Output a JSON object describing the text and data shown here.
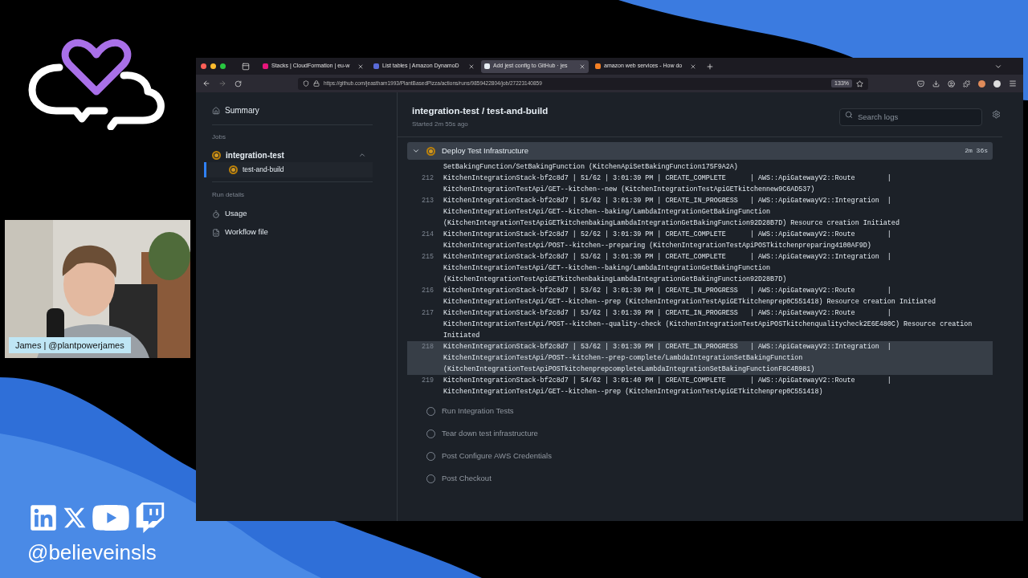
{
  "overlay": {
    "caption": "James | @plantpowerjames",
    "handle": "@believeinsls"
  },
  "browser": {
    "tabs": [
      {
        "title": "Stacks | CloudFormation | eu-w",
        "selected": false,
        "color": "#e7157b"
      },
      {
        "title": "List tables | Amazon DynamoD",
        "selected": false,
        "color": "#5a6bd8"
      },
      {
        "title": "Add jest config to GitHub · jes",
        "selected": true,
        "color": "#e6edf3"
      },
      {
        "title": "amazon web services - How do",
        "selected": false,
        "color": "#f48024"
      }
    ],
    "url": "https://github.com/jeastham1993/PlantBasedPizza/actions/runs/9859422804/job/27223140859",
    "zoom": "133%"
  },
  "sidebar": {
    "summary": "Summary",
    "jobs_heading": "Jobs",
    "jobs": [
      {
        "name": "integration-test",
        "kind": "running",
        "expanded": true,
        "children": [
          {
            "name": "test-and-build",
            "kind": "running",
            "selected": true
          }
        ]
      }
    ],
    "run_details_heading": "Run details",
    "run_details": [
      {
        "label": "Usage",
        "kind": "usage"
      },
      {
        "label": "Workflow file",
        "kind": "workflow"
      }
    ]
  },
  "job": {
    "title": "integration-test / test-and-build",
    "started": "Started 2m 55s ago",
    "search": {
      "placeholder": "Search logs"
    }
  },
  "steps": [
    {
      "name": "Deploy Test Infrastructure",
      "kind": "running",
      "expanded": true,
      "duration": "2m 36s",
      "log": [
        {
          "lines": [
            "SetBakingFunction/SetBakingFunction (KitchenApiSetBakingFunction175F9A2A)"
          ],
          "highlighted": false
        },
        {
          "number": "212",
          "lines": [
            "KitchenIntegrationStack-bf2c8d7 | 51/62 | 3:01:39 PM | CREATE_COMPLETE      | AWS::ApiGatewayV2::Route        |",
            "KitchenIntegrationTestApi/GET--kitchen--new (KitchenIntegrationTestApiGETkitchennew9C6AD537)"
          ],
          "highlighted": false
        },
        {
          "number": "213",
          "lines": [
            "KitchenIntegrationStack-bf2c8d7 | 51/62 | 3:01:39 PM | CREATE_IN_PROGRESS   | AWS::ApiGatewayV2::Integration  |",
            "KitchenIntegrationTestApi/GET--kitchen--baking/LambdaIntegrationGetBakingFunction",
            "(KitchenIntegrationTestApiGETkitchenbakingLambdaIntegrationGetBakingFunction92D28B7D) Resource creation Initiated"
          ],
          "highlighted": false
        },
        {
          "number": "214",
          "lines": [
            "KitchenIntegrationStack-bf2c8d7 | 52/62 | 3:01:39 PM | CREATE_COMPLETE      | AWS::ApiGatewayV2::Route        |",
            "KitchenIntegrationTestApi/POST--kitchen--preparing (KitchenIntegrationTestApiPOSTkitchenpreparing4100AF9D)"
          ],
          "highlighted": false
        },
        {
          "number": "215",
          "lines": [
            "KitchenIntegrationStack-bf2c8d7 | 53/62 | 3:01:39 PM | CREATE_COMPLETE      | AWS::ApiGatewayV2::Integration  |",
            "KitchenIntegrationTestApi/GET--kitchen--baking/LambdaIntegrationGetBakingFunction",
            "(KitchenIntegrationTestApiGETkitchenbakingLambdaIntegrationGetBakingFunction92D28B7D)"
          ],
          "highlighted": false
        },
        {
          "number": "216",
          "lines": [
            "KitchenIntegrationStack-bf2c8d7 | 53/62 | 3:01:39 PM | CREATE_IN_PROGRESS   | AWS::ApiGatewayV2::Route        |",
            "KitchenIntegrationTestApi/GET--kitchen--prep (KitchenIntegrationTestApiGETkitchenprep0C551418) Resource creation Initiated"
          ],
          "highlighted": false
        },
        {
          "number": "217",
          "lines": [
            "KitchenIntegrationStack-bf2c8d7 | 53/62 | 3:01:39 PM | CREATE_IN_PROGRESS   | AWS::ApiGatewayV2::Route        |",
            "KitchenIntegrationTestApi/POST--kitchen--quality-check (KitchenIntegrationTestApiPOSTkitchenqualitycheck2E6E480C) Resource creation",
            "Initiated"
          ],
          "highlighted": false
        },
        {
          "number": "218",
          "lines": [
            "KitchenIntegrationStack-bf2c8d7 | 53/62 | 3:01:39 PM | CREATE_IN_PROGRESS   | AWS::ApiGatewayV2::Integration  |",
            "KitchenIntegrationTestApi/POST--kitchen--prep-complete/LambdaIntegrationSetBakingFunction",
            "(KitchenIntegrationTestApiPOSTkitchenprepcompleteLambdaIntegrationSetBakingFunctionF8C4B981)"
          ],
          "highlighted": true
        },
        {
          "number": "219",
          "lines": [
            "KitchenIntegrationStack-bf2c8d7 | 54/62 | 3:01:40 PM | CREATE_COMPLETE      | AWS::ApiGatewayV2::Route        |",
            "KitchenIntegrationTestApi/GET--kitchen--prep (KitchenIntegrationTestApiGETkitchenprep0C551418)"
          ],
          "highlighted": false
        }
      ]
    },
    {
      "name": "Run Integration Tests",
      "kind": "pending",
      "expanded": false
    },
    {
      "name": "Tear down test infrastructure",
      "kind": "pending",
      "expanded": false
    },
    {
      "name": "Post Configure AWS Credentials",
      "kind": "pending",
      "expanded": false
    },
    {
      "name": "Post Checkout",
      "kind": "pending",
      "expanded": false
    }
  ]
}
